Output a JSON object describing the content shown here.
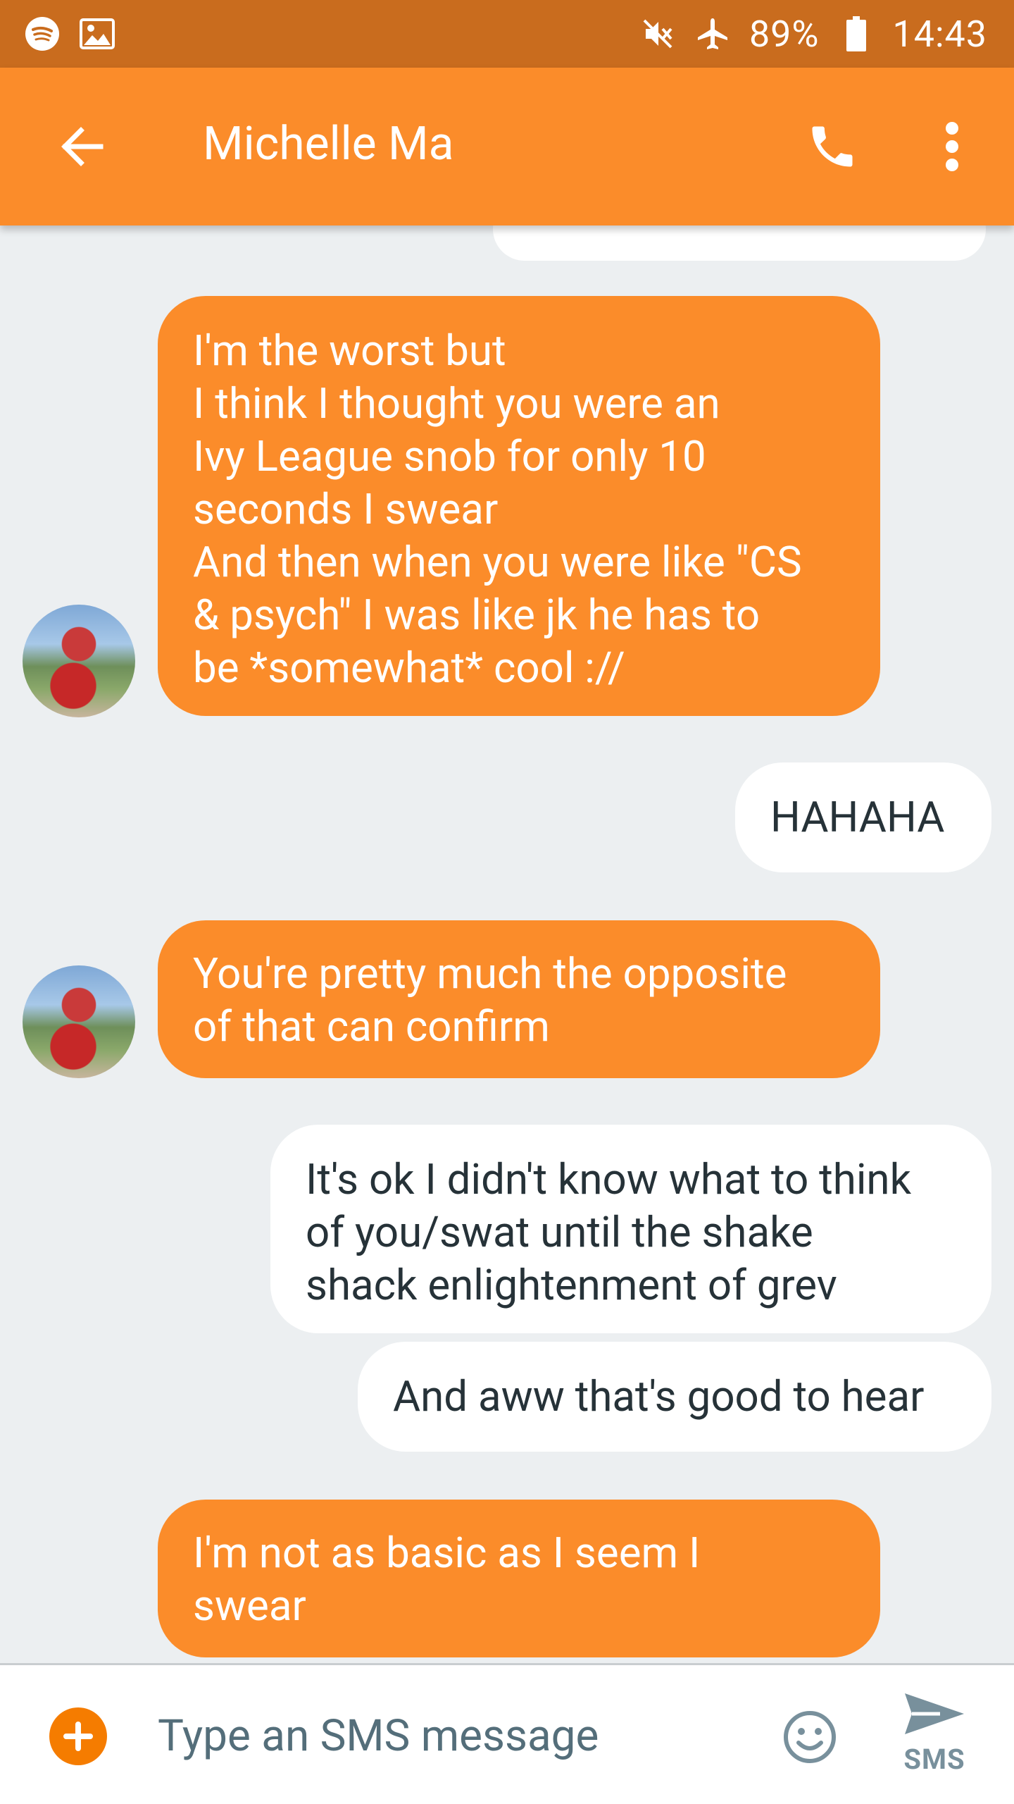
{
  "status_bar": {
    "battery": "89%",
    "time": "14:43",
    "icons": [
      "spotify-icon",
      "image-icon",
      "mute-icon",
      "airplane-icon",
      "battery-icon"
    ]
  },
  "app_bar": {
    "title": "Michelle Ma",
    "icons": [
      "back-arrow-icon",
      "phone-icon",
      "more-vert-icon"
    ]
  },
  "messages": [
    {
      "direction": "in",
      "text": "I'm the worst but\nI think I thought you were an\nIvy League snob for only 10\nseconds I swear\nAnd then when you were like \"CS\n& psych\" I was like jk he has to\nbe *somewhat* cool ://"
    },
    {
      "direction": "out",
      "text": "HAHAHA"
    },
    {
      "direction": "in",
      "text": "You're pretty much the opposite\nof that can confirm"
    },
    {
      "direction": "out",
      "text": "It's ok I didn't know what to think\nof you/swat until the shake\nshack enlightenment of grev"
    },
    {
      "direction": "out",
      "text": "And aww that's good to hear"
    },
    {
      "direction": "in",
      "text": "I'm not as basic as I seem I\nswear"
    }
  ],
  "composer": {
    "placeholder": "Type an SMS message",
    "send_label": "SMS"
  },
  "colors": {
    "status_bar": "#c96c1e",
    "app_bar": "#fb8c2a",
    "incoming_bubble": "#fb8c2a",
    "outgoing_bubble": "#ffffff",
    "background": "#eceff1"
  }
}
